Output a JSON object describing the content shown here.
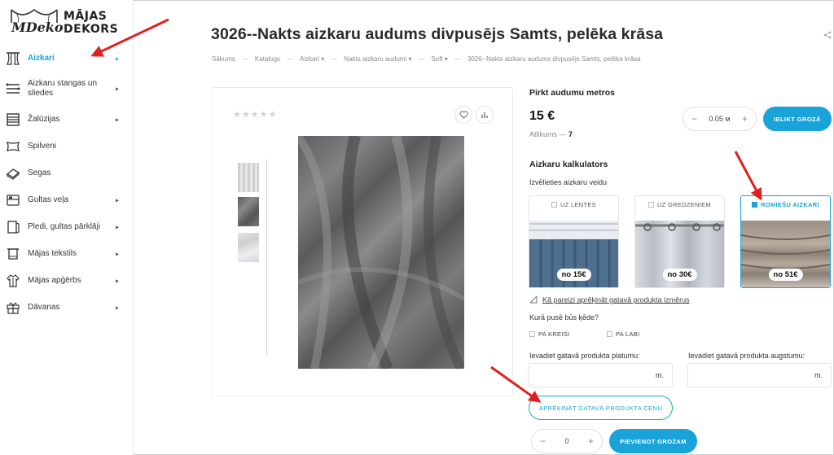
{
  "brand": {
    "script": "MDeko",
    "line1": "MĀJAS",
    "line2": "DEKORS"
  },
  "sidebar": {
    "items": [
      {
        "label": "Aizkari",
        "icon": "curtains-icon",
        "active": true,
        "arrow": true
      },
      {
        "label": "Aizkaru stangas un sliedes",
        "icon": "curtain-rod-icon",
        "active": false,
        "arrow": true
      },
      {
        "label": "Žalūzijas",
        "icon": "blinds-icon",
        "active": false,
        "arrow": true
      },
      {
        "label": "Spilveni",
        "icon": "pillow-icon",
        "active": false,
        "arrow": false
      },
      {
        "label": "Segas",
        "icon": "blanket-icon",
        "active": false,
        "arrow": false
      },
      {
        "label": "Gultas veļa",
        "icon": "bedding-icon",
        "active": false,
        "arrow": true
      },
      {
        "label": "Pledi, gultas pārklāji",
        "icon": "throw-icon",
        "active": false,
        "arrow": true
      },
      {
        "label": "Mājas tekstils",
        "icon": "towel-icon",
        "active": false,
        "arrow": true
      },
      {
        "label": "Mājas apģērbs",
        "icon": "robe-icon",
        "active": false,
        "arrow": true
      },
      {
        "label": "Dāvanas",
        "icon": "gift-icon",
        "active": false,
        "arrow": true
      }
    ],
    "arrow_glyph": "▸"
  },
  "product": {
    "title": "3026--Nakts aizkaru audums divpusējs Samts, pelēka krāsa",
    "breadcrumbs": [
      "Sākums",
      "Katalogs",
      "Aizkari ▾",
      "Nakts aizkaru audumi ▾",
      "Soft ▾",
      "3026--Nakts aizkaru audums divpusējs Samts, pelēka krāsa"
    ],
    "breadcrumb_sep": "—",
    "rating_stars": "★★★★★"
  },
  "buy": {
    "heading": "Pirkt audumu metros",
    "price": "15 €",
    "stock_label": "Atlikums —",
    "stock_value": "7",
    "qty_value": "0.05",
    "qty_unit": "м",
    "minus": "−",
    "plus": "+",
    "cart_button": "IELIKT GROZĀ"
  },
  "calculator": {
    "heading": "Aizkaru kalkulators",
    "choose_label": "Izvēlieties aizkaru veidu",
    "types": [
      {
        "label": "UZ LENTES",
        "price": "no 15€",
        "selected": false
      },
      {
        "label": "UZ GREDZENIEM",
        "price": "no 30€",
        "selected": false
      },
      {
        "label": "ROMIEŠU AIZKARI",
        "price": "no 51€",
        "selected": true
      }
    ],
    "measure_link": "Kā pareizi aprēķināt gatavā produkta izmērus",
    "chain_question": "Kurā pusē būs ķēde?",
    "chain_left": "PA KREISI",
    "chain_right": "PA LABI",
    "width_label": "Ievadiet gatavā produkta platumu:",
    "height_label": "Ievadiet gatavā produkta augstumu:",
    "unit": "m.",
    "calc_button": "APRĒĶINĀT GATAVĀ PRODUKTA CENU",
    "bottom_qty": "0",
    "add_button": "PIEVIENOT GROZAM"
  },
  "colors": {
    "accent": "#1aa3d8",
    "annotation": "#e02020"
  }
}
